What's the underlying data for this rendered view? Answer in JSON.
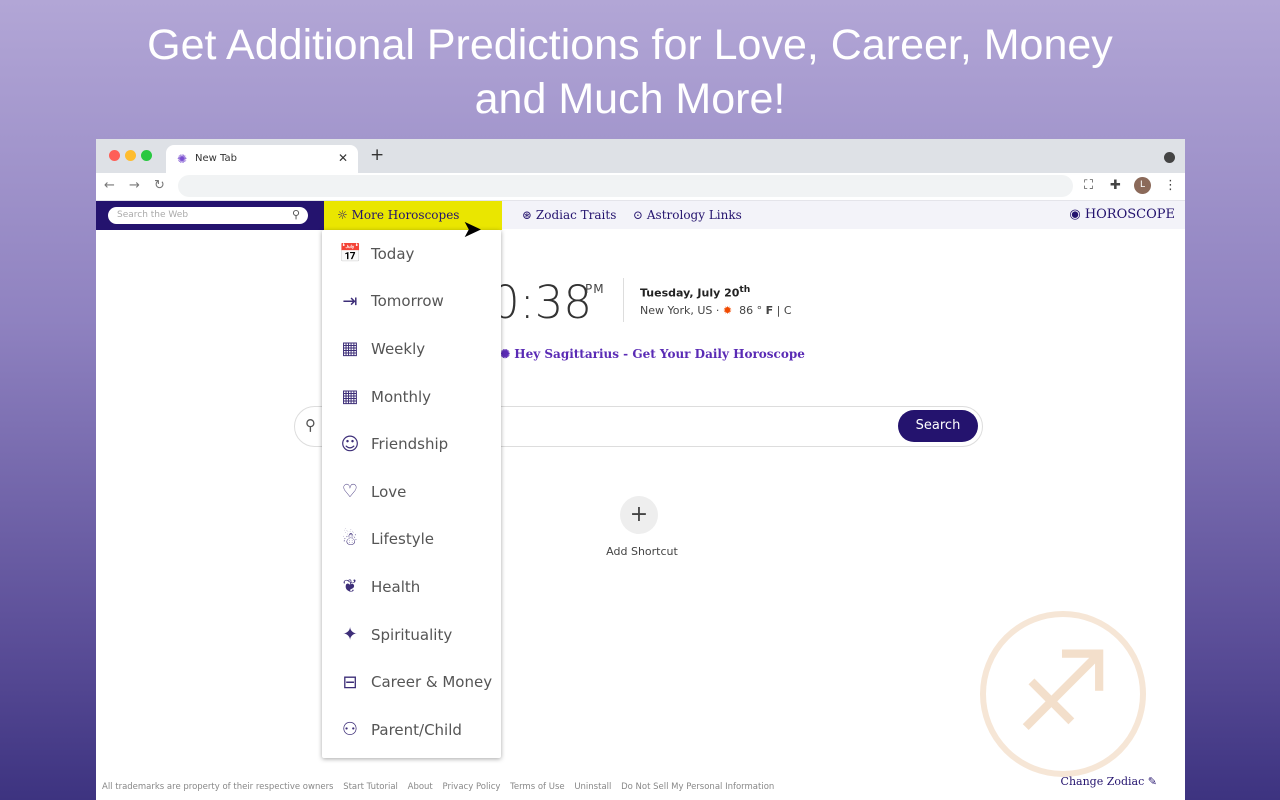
{
  "headline": [
    "Get Additional Predictions for Love, Career, Money",
    "and Much More!"
  ],
  "browser": {
    "tab_title": "New Tab",
    "new_tab": "+",
    "profile_initial": "L"
  },
  "navbar": {
    "search_placeholder": "Search the Web",
    "more_horoscopes": "More  Horoscopes",
    "zodiac_traits": "Zodiac Traits",
    "astrology_links": "Astrology Links",
    "brand": "HOROSCOPE"
  },
  "dropdown": [
    {
      "label": "Today",
      "icon": "calendar-check"
    },
    {
      "label": "Tomorrow",
      "icon": "calendar-arrow"
    },
    {
      "label": "Weekly",
      "icon": "calendar-week"
    },
    {
      "label": "Monthly",
      "icon": "calendar-month"
    },
    {
      "label": "Friendship",
      "icon": "friends"
    },
    {
      "label": "Love",
      "icon": "heart"
    },
    {
      "label": "Lifestyle",
      "icon": "person"
    },
    {
      "label": "Health",
      "icon": "lotus-hands"
    },
    {
      "label": "Spirituality",
      "icon": "sparkles"
    },
    {
      "label": "Career & Money",
      "icon": "briefcase"
    },
    {
      "label": "Parent/Child",
      "icon": "parent-child"
    }
  ],
  "clock": {
    "time": "0:38",
    "ampm": "PM",
    "date": "Tuesday, July 20",
    "date_sup": "th",
    "location": "New York, US ·",
    "temp": "86 °",
    "unit_f": "F",
    "unit_sep": "|",
    "unit_c": "C"
  },
  "greeting": "Hey Sagittarius - Get Your Daily Horoscope",
  "search": {
    "button": "Search"
  },
  "shortcut": {
    "label": "Add Shortcut"
  },
  "footer": [
    "All trademarks are property of their respective owners",
    "Start Tutorial",
    "About",
    "Privacy Policy",
    "Terms of Use",
    "Uninstall",
    "Do Not Sell My Personal Information"
  ],
  "change_zodiac": "Change Zodiac"
}
